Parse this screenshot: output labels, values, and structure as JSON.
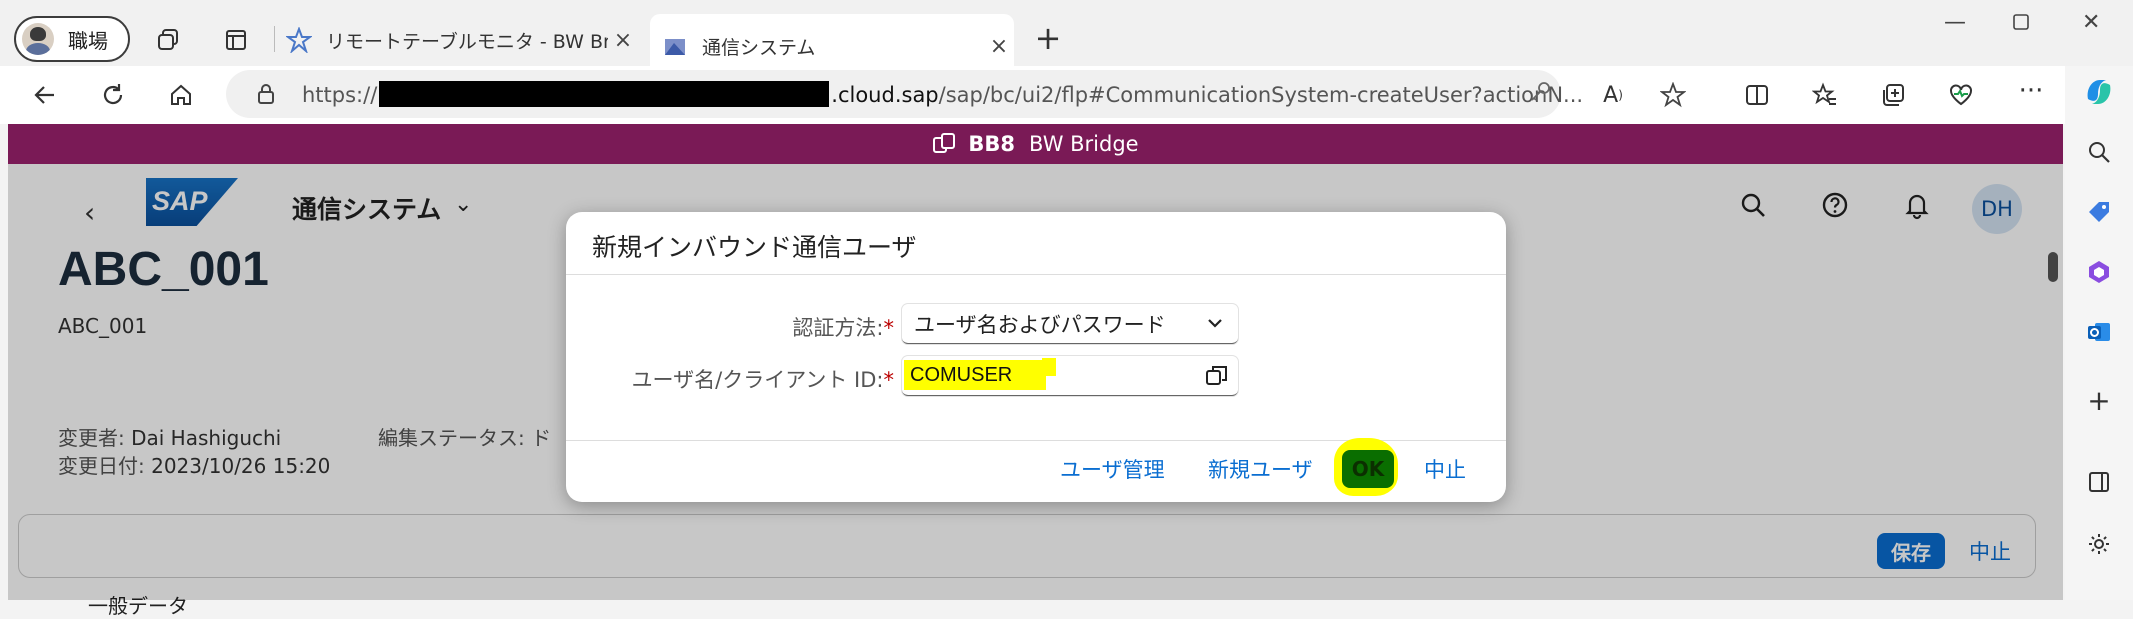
{
  "browser": {
    "profile_label": "職場",
    "tabs": [
      {
        "title": "リモートテーブルモニタ - BW Bridge (S",
        "active": false
      },
      {
        "title": "通信システム",
        "active": true
      }
    ],
    "url_prefix": "https://",
    "url_host": ".cloud.sap",
    "url_path": "/sap/bc/ui2/flp#CommunicationSystem-createUser?actionN..."
  },
  "shell": {
    "system_id": "BB8",
    "system_name": "BW Bridge"
  },
  "app": {
    "title": "通信システム",
    "user_initials": "DH",
    "object_title": "ABC_001",
    "object_subtitle": "ABC_001",
    "changed_by_label": "変更者:",
    "changed_by_value": "Dai Hashiguchi",
    "changed_on_label": "変更日付:",
    "changed_on_value": "2023/10/26 15:20",
    "edit_status_label": "編集ステータス: ド",
    "footer_save": "保存",
    "footer_cancel": "中止",
    "section_peek": "一般データ"
  },
  "dialog": {
    "title": "新規インバウンド通信ユーザ",
    "auth_label": "認証方法:",
    "auth_value": "ユーザ名およびパスワード",
    "user_label": "ユーザ名/クライアント ID:",
    "user_value": "COMUSER",
    "required_mark": "*",
    "link_user_mgmt": "ユーザ管理",
    "link_new_user": "新規ユーザ",
    "ok_label": "OK",
    "cancel_label": "中止"
  },
  "colors": {
    "shellbar": "#7a1a56",
    "accent": "#0a6ed1",
    "highlight": "#ffff00"
  }
}
